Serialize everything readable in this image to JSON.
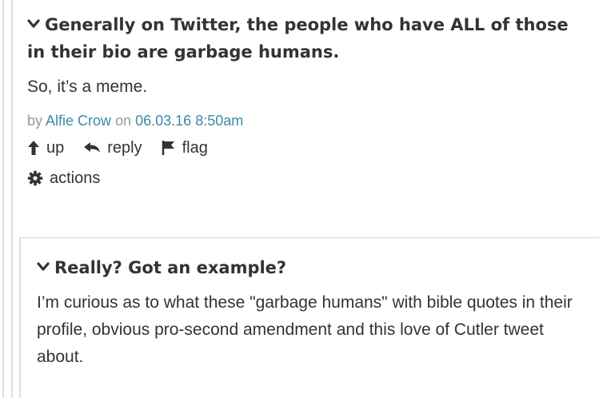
{
  "comment1": {
    "title": "Generally on Twitter, the people who have ALL of those in their bio are garbage humans.",
    "body": "So, it’s a meme.",
    "by_prefix": "by",
    "author": "Alfie Crow",
    "on_word": "on",
    "timestamp": "06.03.16 8:50am",
    "actions": {
      "up": "up",
      "reply": "reply",
      "flag": "flag",
      "more": "actions"
    }
  },
  "comment2": {
    "title": "Really? Got an example?",
    "body": "I’m curious as to what these \"garbage humans\" with bible quotes in their profile, obvious pro-second amendment and this love of Cutler tweet about."
  },
  "icons": [
    "chevron-down-icon",
    "arrow-up-icon",
    "reply-arrow-icon",
    "flag-icon",
    "gear-icon"
  ],
  "colors": {
    "link": "#3d8aa6",
    "meta": "#999999",
    "text": "#333333"
  }
}
